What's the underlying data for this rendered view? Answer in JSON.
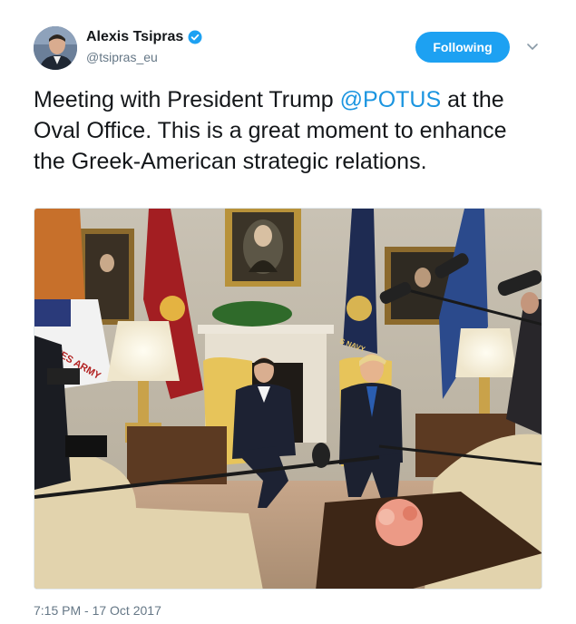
{
  "tweet": {
    "author": {
      "display_name": "Alexis Tsipras",
      "handle": "@tsipras_eu",
      "verified_icon": "verified-badge-icon"
    },
    "follow_button_label": "Following",
    "menu_icon": "chevron-down-icon",
    "text_parts": {
      "before": "Meeting with President Trump ",
      "mention": "@POTUS",
      "after": " at the Oval Office. This is a great moment to enhance the Greek-American strategic relations."
    },
    "timestamp": "7:15 PM - 17 Oct 2017",
    "photo": {
      "flag_text_army": "STATES ARMY",
      "flag_text_navy": "S NAVY"
    }
  },
  "colors": {
    "accent": "#1da1f2",
    "mention": "#1b95e0",
    "muted": "#657786",
    "text": "#14171a"
  }
}
